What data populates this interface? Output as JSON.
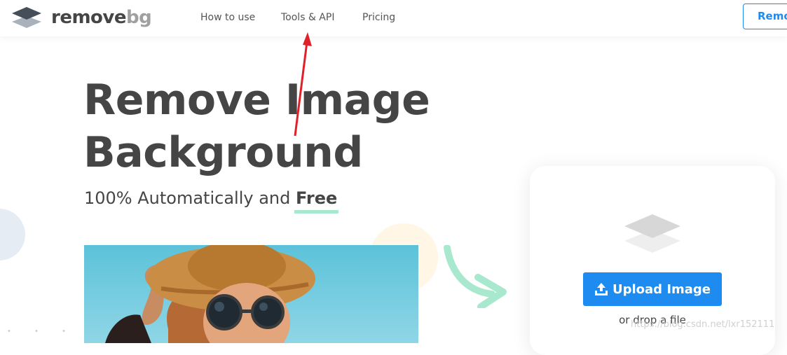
{
  "header": {
    "logo": {
      "part1": "remove",
      "part2": "bg",
      "icon": "layers-icon"
    },
    "nav": [
      {
        "label": "How to use"
      },
      {
        "label": "Tools & API"
      },
      {
        "label": "Pricing"
      }
    ],
    "cta_label": "Remov"
  },
  "hero": {
    "title_line1": "Remove Image",
    "title_line2": "Background",
    "subtitle_prefix": "100% Automatically and",
    "subtitle_emphasis": "Free"
  },
  "upload": {
    "button_label": "Upload Image",
    "button_icon": "upload-icon",
    "drop_text": "or drop a file",
    "card_icon": "layers-icon"
  },
  "watermark": "https://blog.csdn.net/lxr152111",
  "colors": {
    "accent": "#1e8bf0",
    "text": "#454545",
    "highlight": "#a8e8cf",
    "annotation": "#e0202a"
  }
}
